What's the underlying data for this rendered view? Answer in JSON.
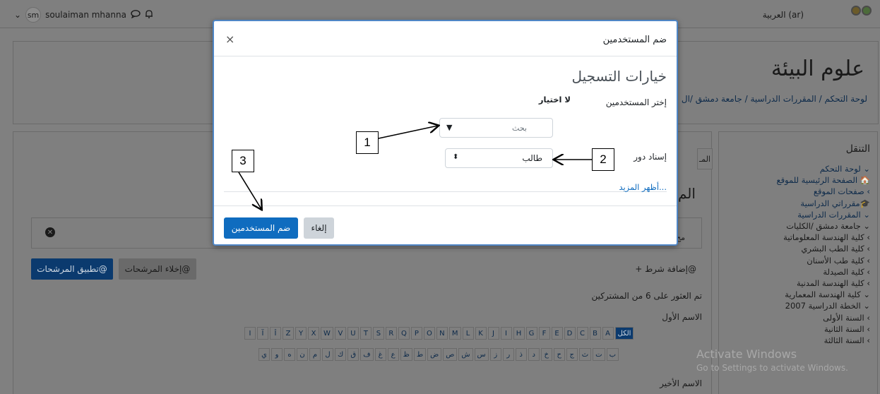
{
  "navbar": {
    "user_initials": "sm",
    "user_name": "soulaiman mhanna",
    "language": "العربية (ar)",
    "user_chevron": "⌄",
    "chat_icon": "message-icon",
    "bell_icon": "bell-icon"
  },
  "course": {
    "title": "علوم البيئة",
    "breadcrumb": "لوحة التحكم / المقررات الدراسية / جامعة دمشق /ال"
  },
  "nav_drawer": {
    "heading": "التنقل",
    "items": [
      "⌄ لوحة التحكم",
      "🏠 الصفحة الرئيسية للموقع",
      "› صفحات الموقع",
      "🎓مقرراتي الدراسية",
      "⌄ المقررات الدراسية",
      "⌄ جامعة دمشق /الكليات",
      "› كلية الهندسة المعلوماتية",
      "› كلية الطب البشري",
      "› كلية طب الأسنان",
      "› كلية الصيدلة",
      "› كلية الهندسة المدنية",
      "⌄ كلية الهندسة المعمارية",
      "⌄ الخطة الدراسية 2007",
      "› السنة الأولى",
      "› السنة الثانية",
      "› السنة الثالثة"
    ]
  },
  "main": {
    "side_tab": "المـ",
    "side_heading": "الم",
    "side_filter_label": "مح",
    "apply_filters": "تطبيق المرشحات@",
    "clear_filters": "إخلاء المرشحات@",
    "add_condition": "+ إضافة شرط@",
    "found_text": "تم العثور على 6 من المشتركين",
    "first_name_label": "الاسم الأول",
    "last_name_label": "الاسم الأخير",
    "all_label": "الكل",
    "latin_letters": [
      "A",
      "B",
      "C",
      "D",
      "E",
      "F",
      "G",
      "H",
      "I",
      "J",
      "K",
      "L",
      "M",
      "N",
      "O",
      "P",
      "Q",
      "R",
      "S",
      "T",
      "U",
      "V",
      "W",
      "X",
      "Y",
      "Z",
      "Î",
      "Ï",
      "I"
    ],
    "arabic_letters": [
      "ب",
      "ت",
      "ث",
      "ج",
      "ح",
      "خ",
      "د",
      "ذ",
      "ر",
      "ز",
      "س",
      "ش",
      "ص",
      "ض",
      "ط",
      "ظ",
      "ع",
      "غ",
      "ف",
      "ق",
      "ك",
      "ل",
      "م",
      "ن",
      "ه",
      "و",
      "ي"
    ]
  },
  "modal": {
    "title": "ضم المستخدمين",
    "close": "×",
    "section_title": "خيارات التسجيل",
    "select_users_label": "إختر المستخدمين",
    "no_selection": "لا اختيار",
    "search_placeholder": "بحث",
    "search_caret": "▼",
    "assign_role_label": "إسناد دور",
    "role_value": "طالب",
    "role_stepper": "⬍",
    "show_more": "أظهر المزيد...",
    "enrol_button": "ضم المستخدمين",
    "cancel_button": "إلغاء"
  },
  "callouts": [
    "1",
    "2",
    "3"
  ],
  "watermark": {
    "line1": "Activate Windows",
    "line2": "Go to Settings to activate Windows."
  },
  "colors": {
    "accent": "#0f6cbf",
    "modal_border": "#4f86c6",
    "overlay": "#7f7f7f"
  }
}
